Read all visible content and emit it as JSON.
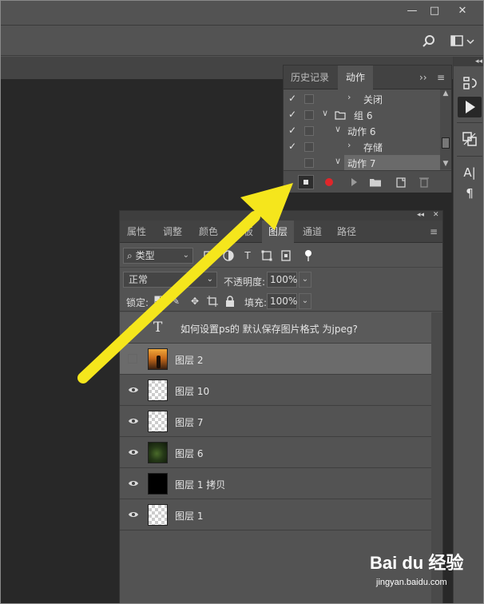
{
  "window": {
    "minimize_glyph": "—",
    "maximize_glyph": "□",
    "close_glyph": "✕"
  },
  "right_strip": {
    "collapse_glyph": "◂◂",
    "items": [
      {
        "icon": "history-icon"
      },
      {
        "icon": "play-actions-icon"
      },
      {
        "icon": "swatch-paths-icon"
      },
      {
        "icon": "character-icon",
        "glyph": "A|"
      },
      {
        "icon": "paragraph-icon",
        "glyph": "¶"
      }
    ]
  },
  "actions_panel": {
    "tabs": [
      "历史记录",
      "动作"
    ],
    "active_tab": "动作",
    "menu_glyph": "≡",
    "collapse_glyph": "››",
    "rows": [
      {
        "check": "✓",
        "arrow": "›",
        "label": "关闭"
      },
      {
        "check": "✓",
        "arrow": "∨",
        "label": "组 6"
      },
      {
        "check": "✓",
        "arrow": "∨",
        "label": "动作 6"
      },
      {
        "check": "✓",
        "arrow": "›",
        "label": "存储"
      },
      {
        "check": "",
        "arrow": "∨",
        "label": "动作 7"
      }
    ],
    "footer_buttons": [
      "stop-record",
      "record",
      "play",
      "new-set",
      "new-action",
      "delete"
    ]
  },
  "layers_panel": {
    "collapse_glyph": "◂◂",
    "close_glyph": "✕",
    "tabs": [
      "属性",
      "调整",
      "颜色",
      "色板",
      "图层",
      "通道",
      "路径"
    ],
    "active_tab": "图层",
    "filter_kind": "类型",
    "blend_mode": "正常",
    "opacity_label": "不透明度:",
    "opacity_value": "100%",
    "lock_label": "锁定:",
    "fill_label": "填充:",
    "fill_value": "100%",
    "layers": [
      {
        "name": "如何设置ps的 默认保存图片格式 为jpeg?",
        "kind": "text",
        "visible": true
      },
      {
        "name": "图层 2",
        "kind": "image-sunset",
        "visible": false
      },
      {
        "name": "图层 10",
        "kind": "transparent",
        "visible": true
      },
      {
        "name": "图层 7",
        "kind": "transparent",
        "visible": true
      },
      {
        "name": "图层 6",
        "kind": "green",
        "visible": true
      },
      {
        "name": "图层 1 拷贝",
        "kind": "black",
        "visible": true
      },
      {
        "name": "图层 1",
        "kind": "transparent",
        "visible": true
      }
    ]
  },
  "overlay": {
    "arrow_color": "#f5e61c"
  },
  "watermark": {
    "brand": "Bai du 经验",
    "url": "jingyan.baidu.com"
  }
}
